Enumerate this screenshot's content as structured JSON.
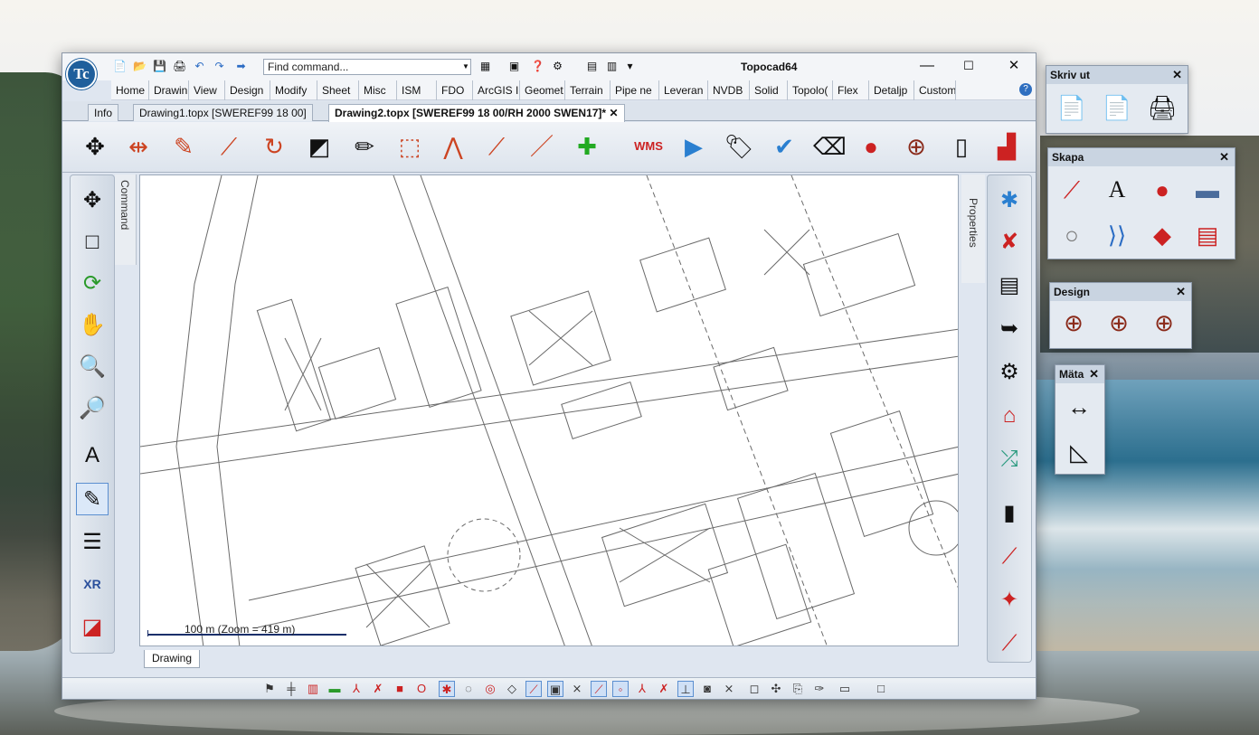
{
  "window": {
    "title": "Topocad64",
    "find_command_placeholder": "Find command...",
    "controls": [
      "—",
      "☐",
      "✕"
    ]
  },
  "menu": [
    "Home",
    "Drawin",
    "View",
    "Design",
    "Modify",
    "Sheet",
    "Misc",
    "ISM",
    "FDO",
    "ArcGIS I",
    "Geomet",
    "Terrain",
    "Pipe ne",
    "Leveran",
    "NVDB",
    "Solid",
    "Topolo(",
    "Flex",
    "Detaljp",
    "Custom"
  ],
  "tabs": [
    {
      "label": "Info"
    },
    {
      "label": "Drawing1.topx [SWEREF99 18 00]"
    },
    {
      "label": "Drawing2.topx [SWEREF99 18 00/RH 2000 SWEN17]*"
    }
  ],
  "tab_close": "✕",
  "side_panels": {
    "command": "Command",
    "properties": "Properties"
  },
  "scale": {
    "label": "100 m (Zoom = 419 m)"
  },
  "drawing_tab": "Drawing",
  "floating_panels": {
    "skriv_ut": {
      "title": "Skriv ut"
    },
    "skapa": {
      "title": "Skapa"
    },
    "design": {
      "title": "Design"
    },
    "mata": {
      "title": "Mäta"
    }
  },
  "icons": {
    "quick_access": [
      "new-file-icon",
      "open-folder-icon",
      "save-icon",
      "print-icon",
      "undo-icon",
      "redo-icon",
      "run-command-icon"
    ],
    "ribbon": [
      "move-icon",
      "break-icon",
      "erase-icon",
      "trim-icon",
      "rotate-icon",
      "scale-icon",
      "edit-icon",
      "select-box-icon",
      "explode-icon",
      "connect-icon",
      "line-icon",
      "add-point-icon",
      "wms-icon",
      "play-icon",
      "tag-icon",
      "check-icon",
      "eraser-icon",
      "point-icon",
      "target-icon",
      "ruler-icon",
      "stairs-icon"
    ],
    "left_toolbar": [
      "pan-icon",
      "window-icon",
      "regen-icon",
      "hand-pan-icon",
      "zoom-icon",
      "zoom-window-icon",
      "text-style-icon",
      "edit-object-icon",
      "list-icon",
      "xref-icon",
      "3d-box-icon"
    ],
    "right_toolbar": [
      "snap-icon",
      "snap-off-icon",
      "layer-icon",
      "export-icon",
      "settings-icon",
      "house-icon",
      "network-icon",
      "pipe-icon",
      "cut-icon",
      "intersect-icon",
      "point-line-icon"
    ]
  }
}
